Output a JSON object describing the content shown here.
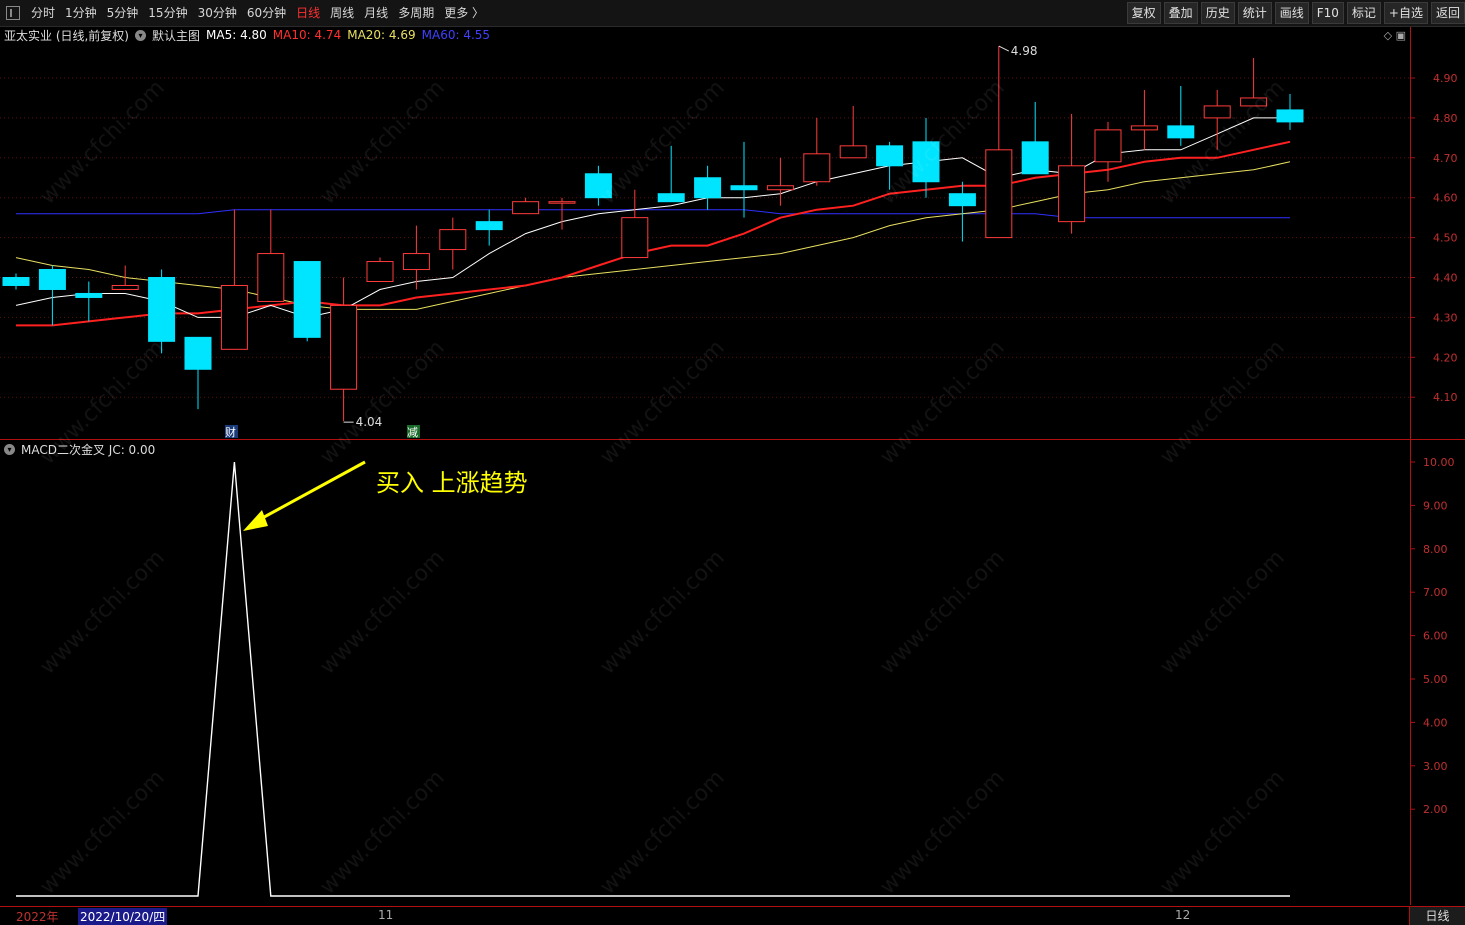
{
  "toolbar": {
    "left_items": [
      "分时",
      "1分钟",
      "5分钟",
      "15分钟",
      "30分钟",
      "60分钟",
      "日线",
      "周线",
      "月线",
      "多周期",
      "更多 〉"
    ],
    "active_index": 6,
    "right_items": [
      "复权",
      "叠加",
      "历史",
      "统计",
      "画线",
      "F10",
      "标记",
      "+自选",
      "返回"
    ]
  },
  "main_info": {
    "stock": "亚太实业 (日线,前复权)",
    "template": "默认主图",
    "ma5": "MA5: 4.80",
    "ma10": "MA10: 4.74",
    "ma20": "MA20: 4.69",
    "ma60": "MA60: 4.55"
  },
  "indicator_info": {
    "title": "MACD二次金叉  JC: 0.00"
  },
  "annotation": {
    "text": "买入 上涨趋势",
    "color": "#ffff00"
  },
  "markers": {
    "high": "4.98",
    "low": "4.04",
    "event1": "财",
    "event2": "减"
  },
  "timebar": {
    "year": "2022年",
    "cursor_date": "2022/10/20/四",
    "month_nov": "11",
    "month_dec": "12",
    "period": "日线"
  },
  "watermark": "www.cfchi.com",
  "colors": {
    "up": "#ff3b3b",
    "down": "#00e5ff",
    "ma5": "#ffffff",
    "ma10": "#ff2020",
    "ma20": "#e8e060",
    "ma60": "#3030ff",
    "axis": "#b01010"
  },
  "chart_data": [
    {
      "type": "candlestick",
      "ylim": [
        4.04,
        4.98
      ],
      "y_ticks": [
        "4.90",
        "4.80",
        "4.70",
        "4.60",
        "4.50",
        "4.40",
        "4.30",
        "4.20",
        "4.10"
      ],
      "candles": [
        {
          "o": 4.4,
          "h": 4.41,
          "l": 4.37,
          "c": 4.38
        },
        {
          "o": 4.42,
          "h": 4.43,
          "l": 4.28,
          "c": 4.37
        },
        {
          "o": 4.36,
          "h": 4.39,
          "l": 4.29,
          "c": 4.35
        },
        {
          "o": 4.37,
          "h": 4.43,
          "l": 4.37,
          "c": 4.38
        },
        {
          "o": 4.4,
          "h": 4.42,
          "l": 4.21,
          "c": 4.24
        },
        {
          "o": 4.25,
          "h": 4.25,
          "l": 4.07,
          "c": 4.17
        },
        {
          "o": 4.22,
          "h": 4.57,
          "l": 4.22,
          "c": 4.38
        },
        {
          "o": 4.34,
          "h": 4.57,
          "l": 4.34,
          "c": 4.46
        },
        {
          "o": 4.44,
          "h": 4.44,
          "l": 4.24,
          "c": 4.25
        },
        {
          "o": 4.12,
          "h": 4.4,
          "l": 4.04,
          "c": 4.33
        },
        {
          "o": 4.39,
          "h": 4.45,
          "l": 4.39,
          "c": 4.44
        },
        {
          "o": 4.42,
          "h": 4.53,
          "l": 4.37,
          "c": 4.46
        },
        {
          "o": 4.47,
          "h": 4.55,
          "l": 4.42,
          "c": 4.52
        },
        {
          "o": 4.54,
          "h": 4.57,
          "l": 4.48,
          "c": 4.52
        },
        {
          "o": 4.56,
          "h": 4.6,
          "l": 4.56,
          "c": 4.59
        },
        {
          "o": 4.59,
          "h": 4.6,
          "l": 4.52,
          "c": 4.59
        },
        {
          "o": 4.66,
          "h": 4.68,
          "l": 4.58,
          "c": 4.6
        },
        {
          "o": 4.45,
          "h": 4.62,
          "l": 4.45,
          "c": 4.55
        },
        {
          "o": 4.61,
          "h": 4.73,
          "l": 4.59,
          "c": 4.59
        },
        {
          "o": 4.65,
          "h": 4.68,
          "l": 4.57,
          "c": 4.6
        },
        {
          "o": 4.63,
          "h": 4.74,
          "l": 4.55,
          "c": 4.62
        },
        {
          "o": 4.62,
          "h": 4.7,
          "l": 4.58,
          "c": 4.63
        },
        {
          "o": 4.64,
          "h": 4.8,
          "l": 4.63,
          "c": 4.71
        },
        {
          "o": 4.7,
          "h": 4.83,
          "l": 4.7,
          "c": 4.73
        },
        {
          "o": 4.73,
          "h": 4.74,
          "l": 4.62,
          "c": 4.68
        },
        {
          "o": 4.74,
          "h": 4.8,
          "l": 4.6,
          "c": 4.64
        },
        {
          "o": 4.61,
          "h": 4.64,
          "l": 4.49,
          "c": 4.58
        },
        {
          "o": 4.5,
          "h": 4.98,
          "l": 4.5,
          "c": 4.72
        },
        {
          "o": 4.74,
          "h": 4.84,
          "l": 4.66,
          "c": 4.66
        },
        {
          "o": 4.54,
          "h": 4.81,
          "l": 4.51,
          "c": 4.68
        },
        {
          "o": 4.69,
          "h": 4.79,
          "l": 4.64,
          "c": 4.77
        },
        {
          "o": 4.77,
          "h": 4.87,
          "l": 4.72,
          "c": 4.78
        },
        {
          "o": 4.78,
          "h": 4.88,
          "l": 4.73,
          "c": 4.75
        },
        {
          "o": 4.8,
          "h": 4.87,
          "l": 4.72,
          "c": 4.83
        },
        {
          "o": 4.83,
          "h": 4.95,
          "l": 4.83,
          "c": 4.85
        },
        {
          "o": 4.82,
          "h": 4.86,
          "l": 4.77,
          "c": 4.79
        }
      ],
      "ma5": [
        4.33,
        4.35,
        4.36,
        4.36,
        4.34,
        4.3,
        4.3,
        4.33,
        4.3,
        4.32,
        4.37,
        4.39,
        4.4,
        4.46,
        4.51,
        4.54,
        4.56,
        4.57,
        4.58,
        4.6,
        4.6,
        4.61,
        4.64,
        4.66,
        4.68,
        4.69,
        4.7,
        4.65,
        4.67,
        4.66,
        4.71,
        4.72,
        4.72,
        4.76,
        4.8,
        4.8
      ],
      "ma10": [
        4.28,
        4.28,
        4.29,
        4.3,
        4.31,
        4.31,
        4.32,
        4.33,
        4.34,
        4.33,
        4.33,
        4.35,
        4.36,
        4.37,
        4.38,
        4.4,
        4.43,
        4.46,
        4.48,
        4.48,
        4.51,
        4.55,
        4.57,
        4.58,
        4.61,
        4.62,
        4.63,
        4.63,
        4.65,
        4.66,
        4.67,
        4.69,
        4.7,
        4.7,
        4.72,
        4.74
      ],
      "ma20": [
        4.45,
        4.43,
        4.42,
        4.4,
        4.39,
        4.38,
        4.37,
        4.35,
        4.33,
        4.32,
        4.32,
        4.32,
        4.34,
        4.36,
        4.38,
        4.4,
        4.41,
        4.42,
        4.43,
        4.44,
        4.45,
        4.46,
        4.48,
        4.5,
        4.53,
        4.55,
        4.56,
        4.57,
        4.59,
        4.61,
        4.62,
        4.64,
        4.65,
        4.66,
        4.67,
        4.69
      ],
      "ma60": [
        4.56,
        4.56,
        4.56,
        4.56,
        4.56,
        4.56,
        4.57,
        4.57,
        4.57,
        4.57,
        4.57,
        4.57,
        4.57,
        4.57,
        4.57,
        4.57,
        4.57,
        4.57,
        4.57,
        4.57,
        4.57,
        4.56,
        4.56,
        4.56,
        4.56,
        4.56,
        4.56,
        4.56,
        4.56,
        4.55,
        4.55,
        4.55,
        4.55,
        4.55,
        4.55,
        4.55
      ]
    },
    {
      "type": "line",
      "title": "MACD二次金叉",
      "ylim": [
        0,
        10
      ],
      "y_ticks": [
        "10.00",
        "9.00",
        "8.00",
        "7.00",
        "6.00",
        "5.00",
        "4.00",
        "3.00",
        "2.00"
      ],
      "values": [
        0,
        0,
        0,
        0,
        0,
        0,
        10,
        0,
        0,
        0,
        0,
        0,
        0,
        0,
        0,
        0,
        0,
        0,
        0,
        0,
        0,
        0,
        0,
        0,
        0,
        0,
        0,
        0,
        0,
        0,
        0,
        0,
        0,
        0,
        0,
        0
      ]
    }
  ]
}
